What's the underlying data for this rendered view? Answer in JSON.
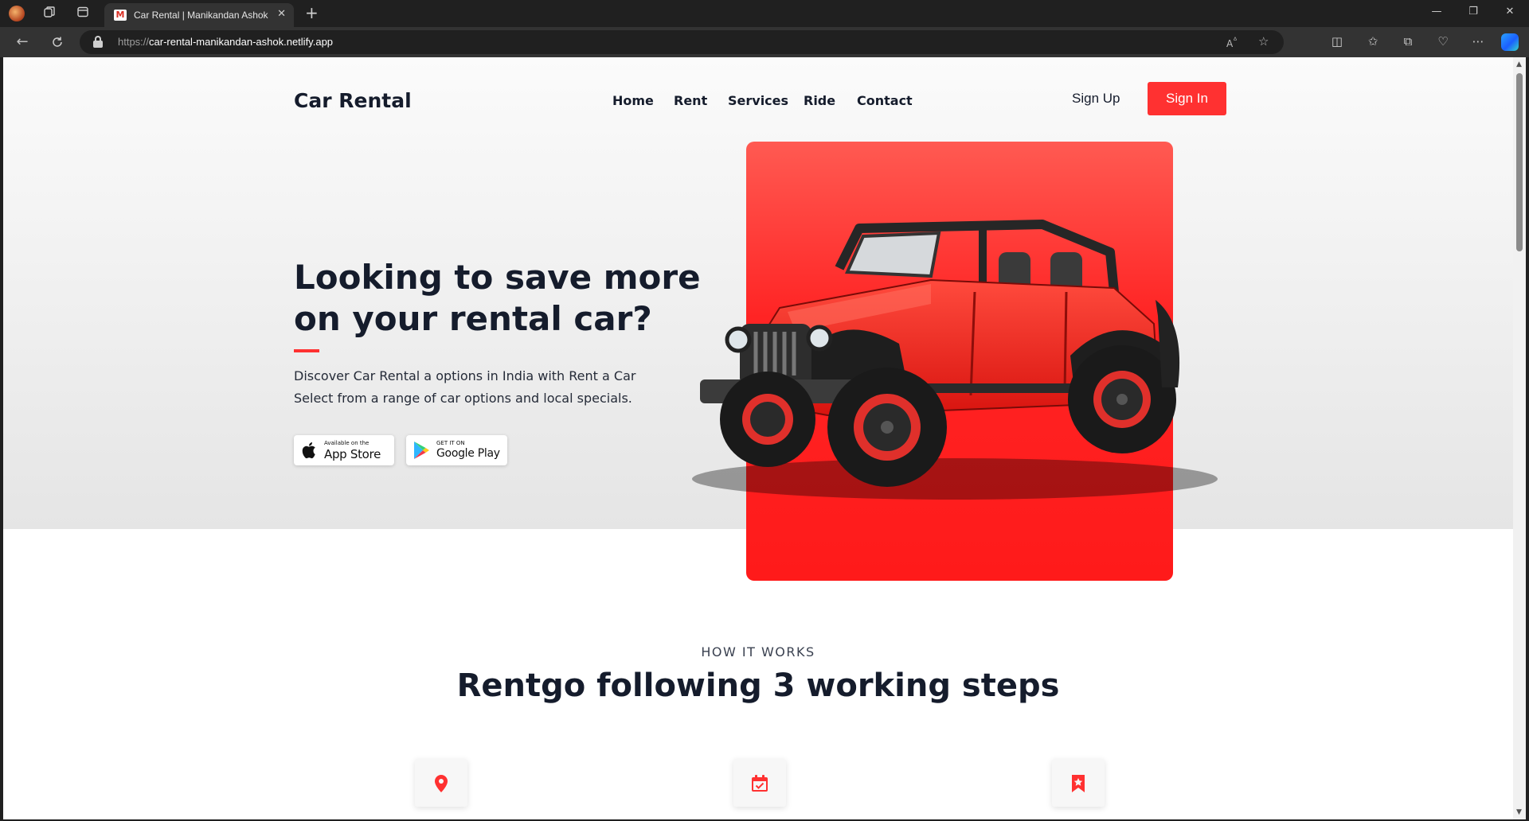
{
  "browser": {
    "tab_title": "Car Rental | Manikandan Ashok",
    "url_scheme": "https://",
    "url_host": "car-rental-manikandan-ashok.netlify.app",
    "icons": [
      "profile-icon",
      "workspaces-icon",
      "tab-actions-icon",
      "back-icon",
      "refresh-icon",
      "read-aloud-icon",
      "favorite-star-icon",
      "split-screen-icon",
      "favorites-icon",
      "collections-icon",
      "browser-essentials-icon",
      "more-icon",
      "copilot-icon"
    ]
  },
  "page": {
    "brand": "Car Rental",
    "nav": [
      {
        "label": "Home"
      },
      {
        "label": "Rent"
      },
      {
        "label": "Services"
      },
      {
        "label": "Ride"
      },
      {
        "label": "Contact"
      }
    ],
    "sign_up": "Sign Up",
    "sign_in": "Sign In",
    "accent_color": "#ff3131",
    "hero": {
      "title": "Looking to save more on your rental car?",
      "description": "Discover Car Rental a options in India with Rent a Car Select from a range of car options and local specials.",
      "app_store": {
        "small": "Available on the",
        "big": "App Store"
      },
      "google_play": {
        "small": "GET IT ON",
        "big": "Google Play"
      }
    },
    "how_it_works": {
      "label": "HOW IT WORKS",
      "title": "Rentgo following 3 working steps",
      "step_icons": [
        "location-pin-icon",
        "calendar-check-icon",
        "bookmark-star-icon"
      ]
    }
  }
}
